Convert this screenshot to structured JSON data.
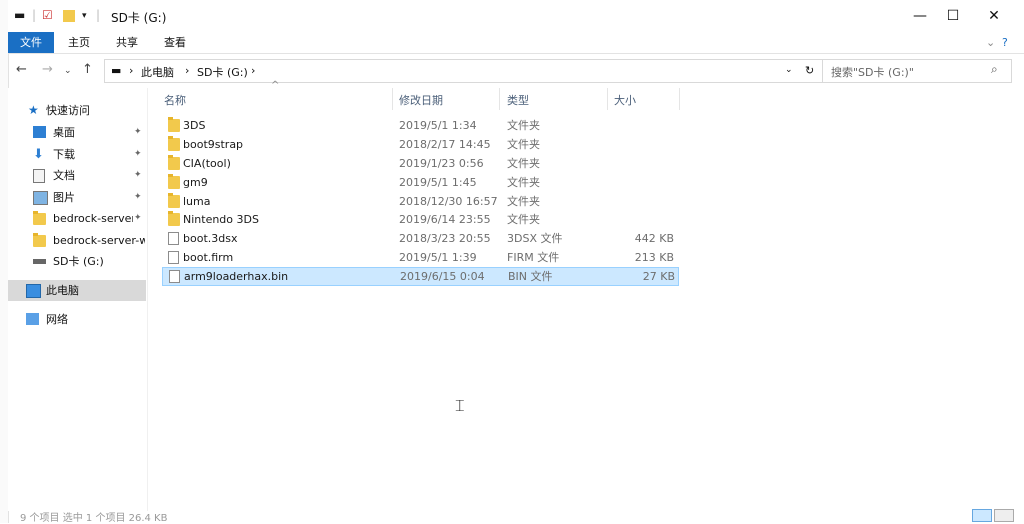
{
  "window": {
    "title": "SD卡 (G:)",
    "minimize": "—",
    "maximize": "☐",
    "close": "✕"
  },
  "ribbon": {
    "tabs": [
      "文件",
      "主页",
      "共享",
      "查看"
    ],
    "help": "?"
  },
  "address": {
    "root": "此电脑",
    "drive": "SD卡 (G:)",
    "sep": "›"
  },
  "search": {
    "placeholder": "搜索\"SD卡 (G:)\""
  },
  "nav": {
    "quick_access": "快速访问",
    "items": [
      {
        "label": "桌面",
        "icon": "desktop-icon",
        "pinned": true
      },
      {
        "label": "下载",
        "icon": "download-icon",
        "pinned": true
      },
      {
        "label": "文档",
        "icon": "documents-icon",
        "pinned": true
      },
      {
        "label": "图片",
        "icon": "pictures-icon",
        "pinned": true
      },
      {
        "label": "bedrock-server",
        "icon": "folder-icon",
        "pinned": true
      },
      {
        "label": "bedrock-server-w",
        "icon": "folder-icon",
        "pinned": false
      },
      {
        "label": "SD卡 (G:)",
        "icon": "drive-icon",
        "pinned": false
      }
    ],
    "this_pc": "此电脑",
    "network": "网络",
    "pin_glyph": "📌"
  },
  "columns": {
    "name": "名称",
    "date": "修改日期",
    "type": "类型",
    "size": "大小"
  },
  "files": [
    {
      "name": "3DS",
      "date": "2019/5/1 1:34",
      "type": "文件夹",
      "size": "",
      "kind": "folder"
    },
    {
      "name": "boot9strap",
      "date": "2018/2/17 14:45",
      "type": "文件夹",
      "size": "",
      "kind": "folder"
    },
    {
      "name": "CIA(tool)",
      "date": "2019/1/23 0:56",
      "type": "文件夹",
      "size": "",
      "kind": "folder"
    },
    {
      "name": "gm9",
      "date": "2019/5/1 1:45",
      "type": "文件夹",
      "size": "",
      "kind": "folder"
    },
    {
      "name": "luma",
      "date": "2018/12/30 16:57",
      "type": "文件夹",
      "size": "",
      "kind": "folder"
    },
    {
      "name": "Nintendo 3DS",
      "date": "2019/6/14 23:55",
      "type": "文件夹",
      "size": "",
      "kind": "folder"
    },
    {
      "name": "boot.3dsx",
      "date": "2018/3/23 20:55",
      "type": "3DSX 文件",
      "size": "442 KB",
      "kind": "file"
    },
    {
      "name": "boot.firm",
      "date": "2019/5/1 1:39",
      "type": "FIRM 文件",
      "size": "213 KB",
      "kind": "file"
    },
    {
      "name": "arm9loaderhax.bin",
      "date": "2019/6/15 0:04",
      "type": "BIN 文件",
      "size": "27 KB",
      "kind": "file",
      "selected": true
    }
  ],
  "status": {
    "text": "9 个项目   选中 1 个项目  26.4 KB"
  },
  "colors": {
    "accent": "#1a6fc4",
    "selection": "#cce8ff",
    "folder": "#f2c94c"
  }
}
